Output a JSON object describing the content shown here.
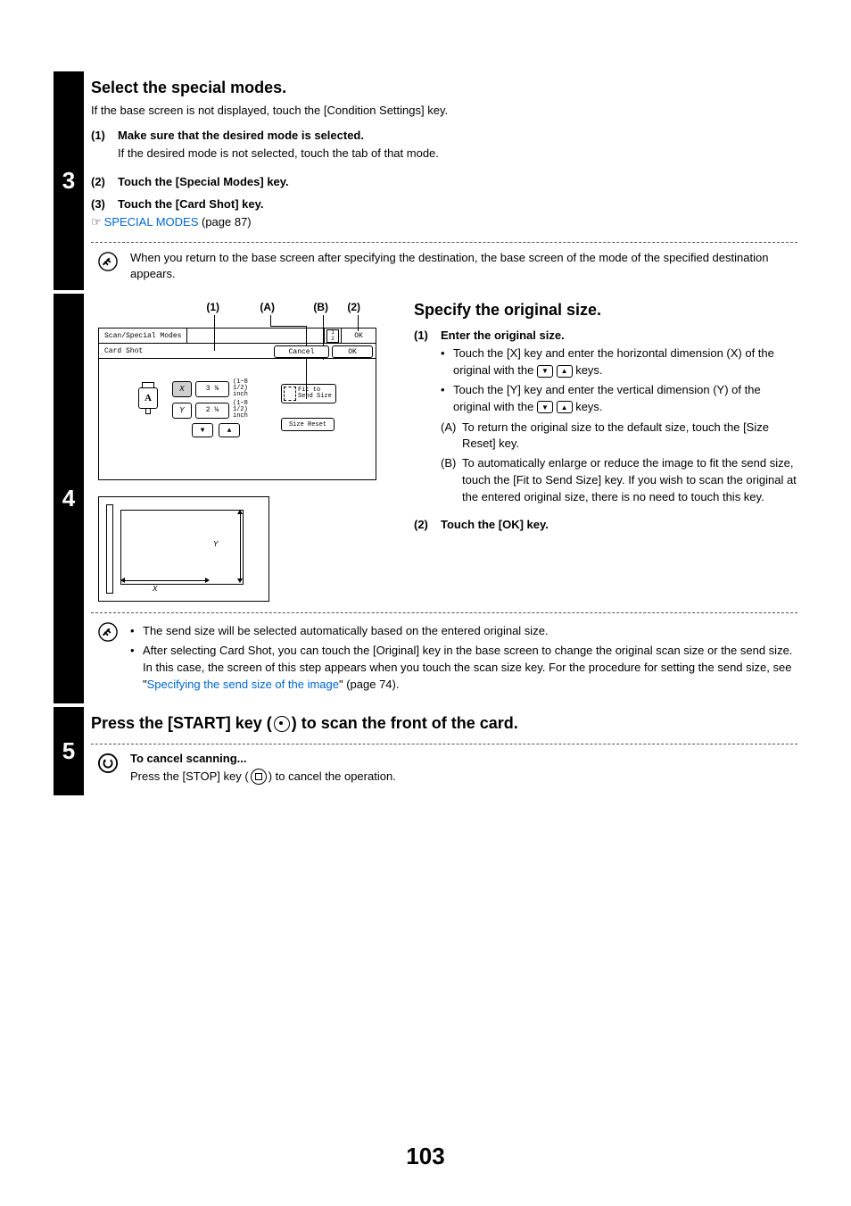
{
  "step3": {
    "num": "3",
    "title": "Select the special modes.",
    "intro": "If the base screen is not displayed, touch the [Condition Settings] key.",
    "sub1": {
      "n": "(1)",
      "head": "Make sure that the desired mode is selected.",
      "body": "If the desired mode is not selected, touch the tab of that mode."
    },
    "sub2": {
      "n": "(2)",
      "head": "Touch the [Special Modes] key."
    },
    "sub3": {
      "n": "(3)",
      "head": "Touch the [Card Shot] key."
    },
    "ref_icon": "☞",
    "ref_link": "SPECIAL MODES",
    "ref_page": " (page 87)",
    "note": "When you return to the base screen after specifying the destination, the base screen of the mode of the specified destination appears."
  },
  "step4": {
    "num": "4",
    "callouts": {
      "c1": "(1)",
      "cA": "(A)",
      "cB": "(B)",
      "c2": "(2)"
    },
    "panel": {
      "tab1": "Scan/Special Modes",
      "top_icon": "1/2",
      "ok": "OK",
      "sub_title": "Card Shot",
      "cancel": "Cancel",
      "ok2": "OK",
      "x": "X",
      "y": "Y",
      "xval": "3 ⅜",
      "yval": "2 ⅛",
      "range": "(1~8 1/2)\ninch",
      "fit": "Fit to\nSend Size",
      "size_reset": "Size Reset",
      "down": "▼",
      "up": "▲"
    },
    "diagram": {
      "y": "Y",
      "x": "X"
    },
    "right": {
      "title": "Specify the original size.",
      "s1n": "(1)",
      "s1h": "Enter the original size.",
      "b1a": "Touch the [X] key and enter the horizontal dimension (X) of the original with the ",
      "b1b": " keys.",
      "b2a": "Touch the [Y] key and enter the vertical dimension (Y) of the original with the ",
      "b2b": " keys.",
      "A": "(A)",
      "Atxt": "To return the original size to the default size, touch the [Size Reset] key.",
      "B": "(B)",
      "Btxt": "To automatically enlarge or reduce the image to fit the send size, touch the [Fit to Send Size] key. If you wish to scan the original at the entered original size, there is no need to touch this key.",
      "s2n": "(2)",
      "s2h": "Touch the [OK] key."
    },
    "note1": "The send size will be selected automatically based on the entered original size.",
    "note2a": "After selecting Card Shot, you can touch the [Original] key in the base screen to change the original scan size or the send size. In this case, the screen of this step appears when you touch the scan size key. For the procedure for setting the send size, see \"",
    "note2link": "Specifying the send size of the image",
    "note2b": "\" (page 74)."
  },
  "step5": {
    "num": "5",
    "title_a": "Press the [START] key (",
    "title_b": ") to scan the front of the card.",
    "sub_head": "To cancel scanning...",
    "sub_a": "Press the [STOP] key (",
    "sub_b": ") to cancel the operation."
  },
  "page_number": "103"
}
